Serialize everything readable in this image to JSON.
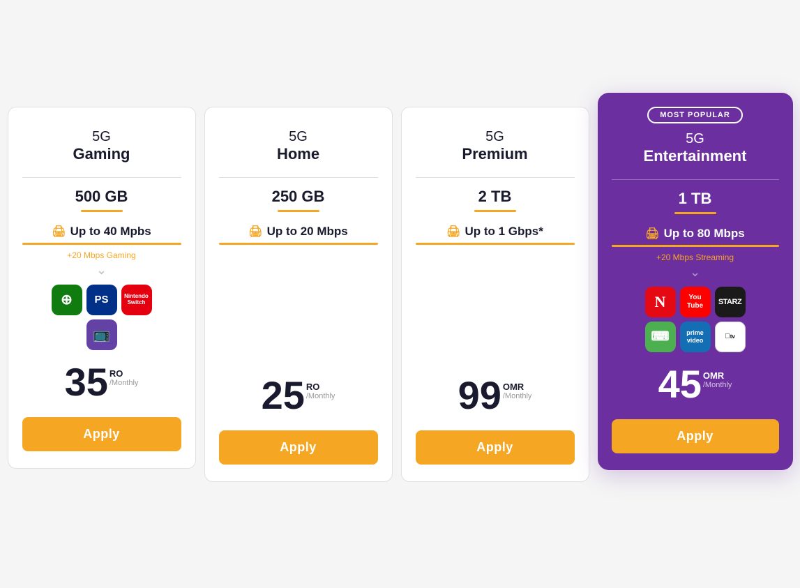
{
  "plans": [
    {
      "id": "gaming",
      "line1": "5G",
      "line2": "Gaming",
      "data": "500 GB",
      "speed": "Up to 40 Mpbs",
      "speedExtra": "+20 Mbps Gaming",
      "priceNumber": "35",
      "priceCurrency": "RO",
      "pricePeriod": "/Monthly",
      "applyLabel": "Apply",
      "popular": false,
      "hasApps": true,
      "appType": "gaming"
    },
    {
      "id": "home",
      "line1": "5G",
      "line2": "Home",
      "data": "250 GB",
      "speed": "Up to 20 Mbps",
      "speedExtra": null,
      "priceNumber": "25",
      "priceCurrency": "RO",
      "pricePeriod": "/Monthly",
      "applyLabel": "Apply",
      "popular": false,
      "hasApps": false,
      "appType": null
    },
    {
      "id": "premium",
      "line1": "5G",
      "line2": "Premium",
      "data": "2 TB",
      "speed": "Up to 1 Gbps*",
      "speedExtra": null,
      "priceNumber": "99",
      "priceCurrency": "OMR",
      "pricePeriod": "/Monthly",
      "applyLabel": "Apply",
      "popular": false,
      "hasApps": false,
      "appType": null
    },
    {
      "id": "entertainment",
      "line1": "5G",
      "line2": "Entertainment",
      "data": "1 TB",
      "speed": "Up to 80 Mbps",
      "speedExtra": "+20 Mbps Streaming",
      "priceNumber": "45",
      "priceCurrency": "OMR",
      "pricePeriod": "/Monthly",
      "applyLabel": "Apply",
      "popular": true,
      "mostPopularLabel": "MOST POPULAR",
      "hasApps": true,
      "appType": "streaming"
    }
  ]
}
